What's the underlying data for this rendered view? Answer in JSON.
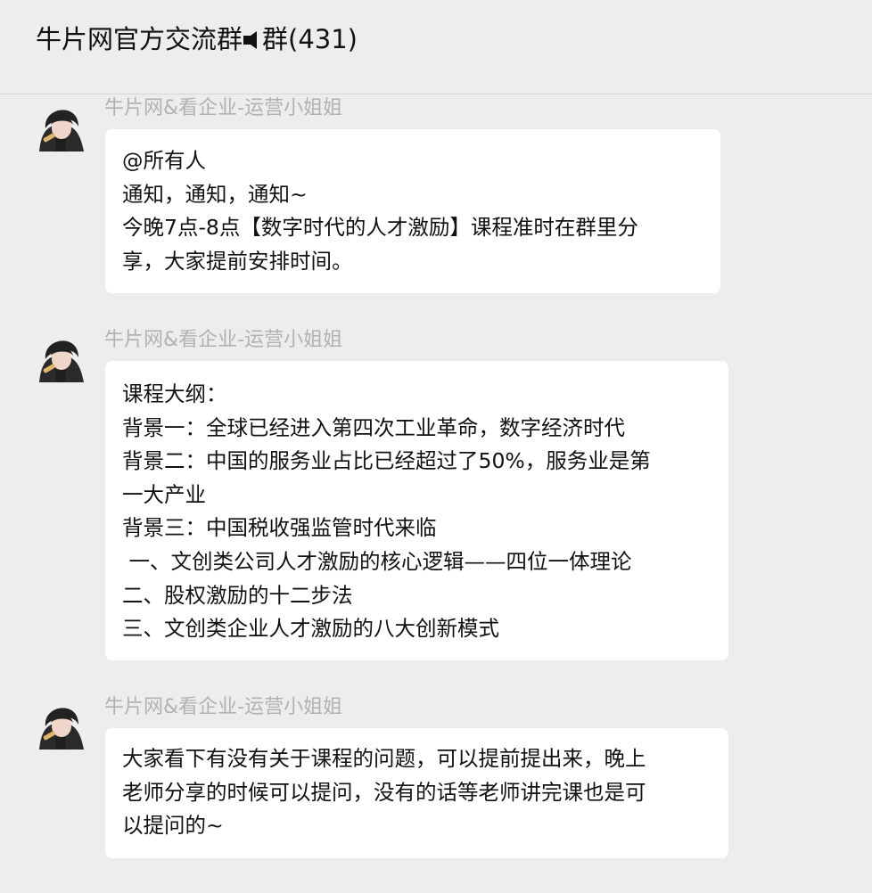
{
  "chat": {
    "title_before_icon": "牛片网官方交流群",
    "title_after_icon": "群(431)",
    "mute_icon": "speaker-muted-icon"
  },
  "messages": [
    {
      "sender": "牛片网&看企业-运营小姐姐",
      "lines": [
        "@所有人",
        "通知，通知，通知~",
        "今晚7点-8点【数字时代的人才激励】课程准时在群里分",
        "享，大家提前安排时间。"
      ]
    },
    {
      "sender": "牛片网&看企业-运营小姐姐",
      "lines": [
        "课程大纲：",
        "背景一：全球已经进入第四次工业革命，数字经济时代",
        "背景二：中国的服务业占比已经超过了50%，服务业是第",
        "一大产业",
        "背景三：中国税收强监管时代来临",
        " 一、文创类公司人才激励的核心逻辑——四位一体理论",
        "二、股权激励的十二步法",
        "三、文创类企业人才激励的八大创新模式"
      ]
    },
    {
      "sender": "牛片网&看企业-运营小姐姐",
      "lines": [
        "大家看下有没有关于课程的问题，可以提前提出来，晚上",
        "老师分享的时候可以提问，没有的话等老师讲完课也是可",
        "以提问的~"
      ]
    }
  ]
}
